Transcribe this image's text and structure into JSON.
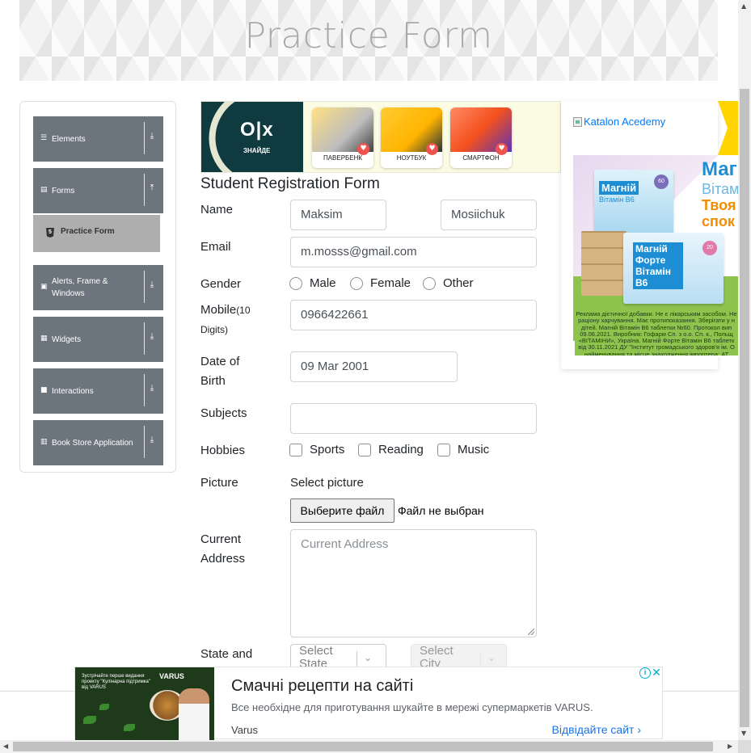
{
  "header": {
    "title": "Practice Form"
  },
  "sidebar": {
    "groups": [
      {
        "label": "Elements",
        "icon": "hamburger-icon",
        "arrow": "⤓"
      },
      {
        "label": "Forms",
        "icon": "document-icon",
        "arrow": "⤒"
      },
      {
        "label": "Alerts, Frame & Windows",
        "icon": "window-icon",
        "arrow": "⤓"
      },
      {
        "label": "Widgets",
        "icon": "grid-icon",
        "arrow": "⤓"
      },
      {
        "label": "Interactions",
        "icon": "square-icon",
        "arrow": "⤓"
      },
      {
        "label": "Book Store Application",
        "icon": "books-icon",
        "arrow": "⤓"
      }
    ],
    "active_item": {
      "label": "Practice Form",
      "icon": "html5-icon"
    }
  },
  "ads": {
    "olx": {
      "brand": "O|x",
      "tagline": "ЗНАЙДЕ",
      "cards": [
        "ПАВЕРБЕНК",
        "НОУТБУК",
        "СМАРТФОН"
      ]
    },
    "katalon": {
      "alt": "Katalon Acedemy"
    },
    "magnesium": {
      "line1": "Магн",
      "line2": "Вітам",
      "line3": "Твоя",
      "line4": "спок",
      "box1_title": "Магній",
      "box1_sub": "Вітамін В6",
      "box1_count": "60",
      "box2_title": "Магній Форте Вітамін В6",
      "box2_count": "20",
      "fine_print": "Реклама дієтичної добавки. Не є лікарським засобом. Не раціону харчування. Має протипоказання. Зберігати у н дітей. Магній Вітамін В6 таблетки №60. Протокол вип 09.06.2021. Виробник: Гофарм Сп. з о.о. Сп. к., Польщ «ВІТАМІНИ», Україна. Магній Форте Вітамін В6 таблетк від 30.11.2021 ДУ \"Інститут громадського здоров'я ім. О найменування та місце знаходження імпортера: АТ"
    },
    "varus": {
      "promo_text": "Зустрічайте перше видання проекту \"Кулінарна підтримка\" від VARUS",
      "logo": "VARUS",
      "headline": "Смачні рецепти на сайті",
      "subline": "Все необхідне для приготування шукайте в мережі супермаркетів VARUS.",
      "brand": "Varus",
      "cta": "Відвідайте сайт",
      "cta_arrow": "›",
      "adchoice": "i",
      "close": "✕"
    }
  },
  "form": {
    "title": "Student Registration Form",
    "name_label": "Name",
    "first_name": "Maksim",
    "last_name": "Mosiichuk",
    "email_label": "Email",
    "email": "m.mosss@gmail.com",
    "gender_label": "Gender",
    "genders": [
      "Male",
      "Female",
      "Other"
    ],
    "mobile_label": "Mobile",
    "mobile_hint": "(10",
    "mobile_hint2": "Digits)",
    "mobile": "0966422661",
    "dob_label_1": "Date of",
    "dob_label_2": "Birth",
    "dob": "09 Mar 2001",
    "subjects_label": "Subjects",
    "subjects": "",
    "hobbies_label": "Hobbies",
    "hobbies": [
      "Sports",
      "Reading",
      "Music"
    ],
    "picture_label": "Picture",
    "picture_hint": "Select picture",
    "file_button": "Выберите файл",
    "file_status": "Файл не выбран",
    "address_label_1": "Current",
    "address_label_2": "Address",
    "address_placeholder": "Current Address",
    "state_label": "State and",
    "state_placeholder": "Select State",
    "city_placeholder": "Select City",
    "chevron": "⌄"
  },
  "scroll": {
    "up": "▲",
    "down": "▼",
    "left": "◀",
    "right": "▶"
  }
}
